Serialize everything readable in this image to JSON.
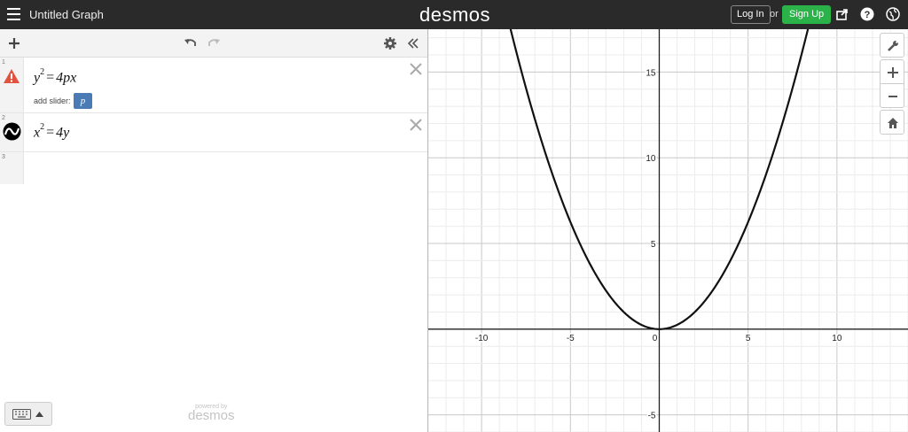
{
  "topbar": {
    "menu_icon": "hamburger-icon",
    "title": "Untitled Graph",
    "logo": "desmos",
    "login_label": "Log In",
    "or_label": "or",
    "signup_label": "Sign Up",
    "signup_color": "#2bb34a",
    "icons": [
      "share-icon",
      "help-icon",
      "globe-icon"
    ]
  },
  "toolbar": {
    "icons": [
      "add-icon",
      "undo-icon",
      "redo-icon",
      "settings-icon",
      "collapse-icon"
    ]
  },
  "expressions": [
    {
      "number": "1",
      "status_icon": "warning-icon",
      "lhs_var": "y",
      "lhs_exp": "2",
      "eq": "=",
      "rhs": "4px",
      "slider_label": "add slider:",
      "slider_var": "p"
    },
    {
      "number": "2",
      "status_icon": "curve-icon",
      "lhs_var": "x",
      "lhs_exp": "2",
      "eq": "=",
      "rhs": "4y"
    },
    {
      "number": "3"
    }
  ],
  "footer": {
    "powered_by": "powered by",
    "logo": "desmos",
    "keyboard_icon": "keyboard-icon"
  },
  "graph": {
    "x_range": [
      -13,
      14
    ],
    "y_range": [
      -6,
      17.5
    ],
    "x_ticks": [
      "-10",
      "-5",
      "0",
      "5",
      "10"
    ],
    "y_ticks": [
      "15",
      "10",
      "5",
      "-5"
    ],
    "curve": "x^2 = 4y",
    "curve_color": "#111111",
    "side_controls": [
      "wrench-icon",
      "zoom-in-icon",
      "zoom-out-icon",
      "home-icon"
    ]
  }
}
